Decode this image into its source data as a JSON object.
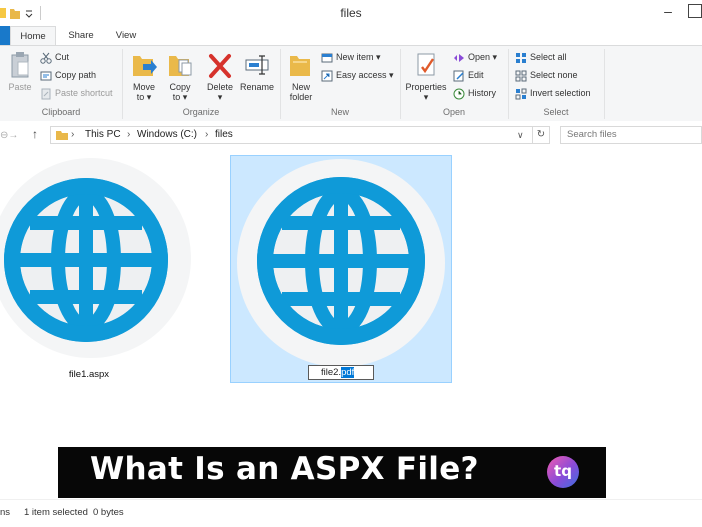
{
  "window": {
    "title": "files"
  },
  "ribbon_tabs": {
    "home": "Home",
    "share": "Share",
    "view": "View"
  },
  "clipboard": {
    "label": "Clipboard",
    "paste": "Paste",
    "cut": "Cut",
    "copy_path": "Copy path",
    "paste_shortcut": "Paste shortcut"
  },
  "organize": {
    "label": "Organize",
    "move_to": [
      "Move",
      "to ▾"
    ],
    "copy_to": [
      "Copy",
      "to ▾"
    ],
    "delete": [
      "Delete",
      "▾"
    ],
    "rename": "Rename"
  },
  "new_group": {
    "label": "New",
    "new_folder": [
      "New",
      "folder"
    ],
    "new_item": "New item ▾",
    "easy_access": "Easy access ▾"
  },
  "open_group": {
    "label": "Open",
    "properties": [
      "Properties",
      "▾"
    ],
    "open": "Open ▾",
    "edit": "Edit",
    "history": "History"
  },
  "select_group": {
    "label": "Select",
    "select_all": "Select all",
    "select_none": "Select none",
    "invert_selection": "Invert selection"
  },
  "address": {
    "this_pc": "This PC",
    "drive": "Windows (C:)",
    "folder": "files",
    "separator": "›",
    "search_placeholder": "Search files"
  },
  "files": [
    {
      "name": "file1.aspx"
    },
    {
      "name_base": "file2.",
      "name_selected": "pdf"
    }
  ],
  "banner": {
    "title": "What Is an ASPX File?",
    "logo": "tq"
  },
  "status": {
    "items_partial": "ns",
    "selected": "1 item selected",
    "size": "0 bytes"
  },
  "colors": {
    "accent": "#1979ca",
    "globe": "#0f9ad8",
    "selection": "#cce8ff",
    "banner_bg": "#070707"
  }
}
